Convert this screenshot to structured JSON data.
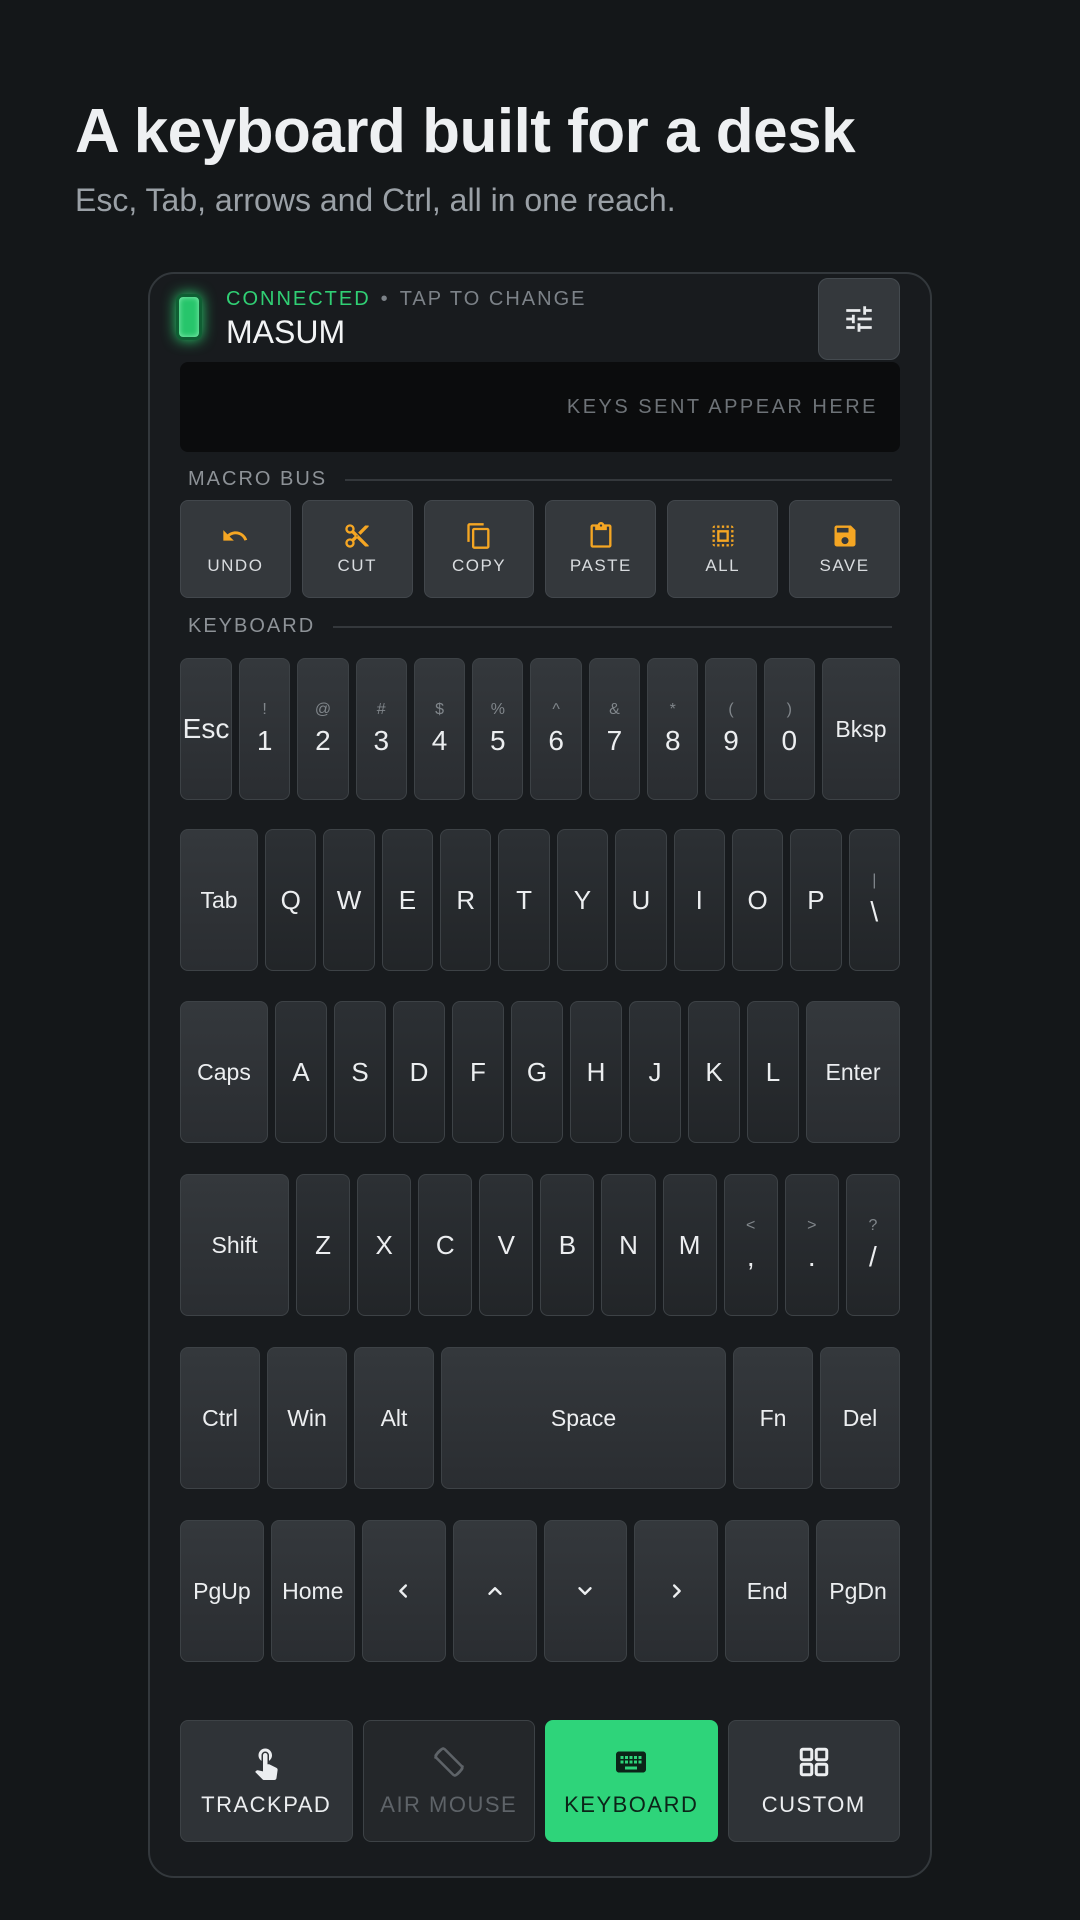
{
  "header": {
    "title": "A keyboard built for a desk",
    "subtitle": "Esc, Tab, arrows and Ctrl, all in one reach."
  },
  "connection": {
    "status": "CONNECTED",
    "action": "TAP TO CHANGE",
    "separator": "•",
    "device_name": "MASUM",
    "status_color": "#30cf74"
  },
  "display": {
    "placeholder": "KEYS SENT APPEAR HERE"
  },
  "macro_bus": {
    "label": "MACRO BUS",
    "items": [
      {
        "label": "UNDO",
        "icon": "undo-icon"
      },
      {
        "label": "CUT",
        "icon": "scissors-icon"
      },
      {
        "label": "COPY",
        "icon": "copy-icon"
      },
      {
        "label": "PASTE",
        "icon": "clipboard-icon"
      },
      {
        "label": "ALL",
        "icon": "select-all-icon"
      },
      {
        "label": "SAVE",
        "icon": "save-icon"
      }
    ],
    "icon_color": "#f5a623"
  },
  "keyboard": {
    "label": "KEYBOARD",
    "row1": {
      "esc": "Esc",
      "digits": [
        {
          "shift": "!",
          "main": "1"
        },
        {
          "shift": "@",
          "main": "2"
        },
        {
          "shift": "#",
          "main": "3"
        },
        {
          "shift": "$",
          "main": "4"
        },
        {
          "shift": "%",
          "main": "5"
        },
        {
          "shift": "^",
          "main": "6"
        },
        {
          "shift": "&",
          "main": "7"
        },
        {
          "shift": "*",
          "main": "8"
        },
        {
          "shift": "(",
          "main": "9"
        },
        {
          "shift": ")",
          "main": "0"
        }
      ],
      "bksp": "Bksp"
    },
    "row2": {
      "tab": "Tab",
      "letters": [
        "Q",
        "W",
        "E",
        "R",
        "T",
        "Y",
        "U",
        "I",
        "O",
        "P"
      ],
      "backslash": {
        "shift": "|",
        "main": "\\"
      }
    },
    "row3": {
      "caps": "Caps",
      "letters": [
        "A",
        "S",
        "D",
        "F",
        "G",
        "H",
        "J",
        "K",
        "L"
      ],
      "enter": "Enter"
    },
    "row4": {
      "shift": "Shift",
      "letters": [
        "Z",
        "X",
        "C",
        "V",
        "B",
        "N",
        "M"
      ],
      "punct": [
        {
          "shift": "<",
          "main": ","
        },
        {
          "shift": ">",
          "main": "."
        },
        {
          "shift": "?",
          "main": "/"
        }
      ]
    },
    "row5": {
      "ctrl": "Ctrl",
      "win": "Win",
      "alt": "Alt",
      "space": "Space",
      "fn": "Fn",
      "del": "Del"
    },
    "row6": {
      "pgup": "PgUp",
      "home": "Home",
      "end": "End",
      "pgdn": "PgDn"
    }
  },
  "bottom_nav": {
    "items": [
      {
        "label": "TRACKPAD",
        "icon": "touch-icon",
        "state": "normal"
      },
      {
        "label": "AIR MOUSE",
        "icon": "rotate-icon",
        "state": "disabled"
      },
      {
        "label": "KEYBOARD",
        "icon": "keyboard-icon",
        "state": "active"
      },
      {
        "label": "CUSTOM",
        "icon": "grid-icon",
        "state": "normal"
      }
    ],
    "active_color": "#2ed47a"
  }
}
